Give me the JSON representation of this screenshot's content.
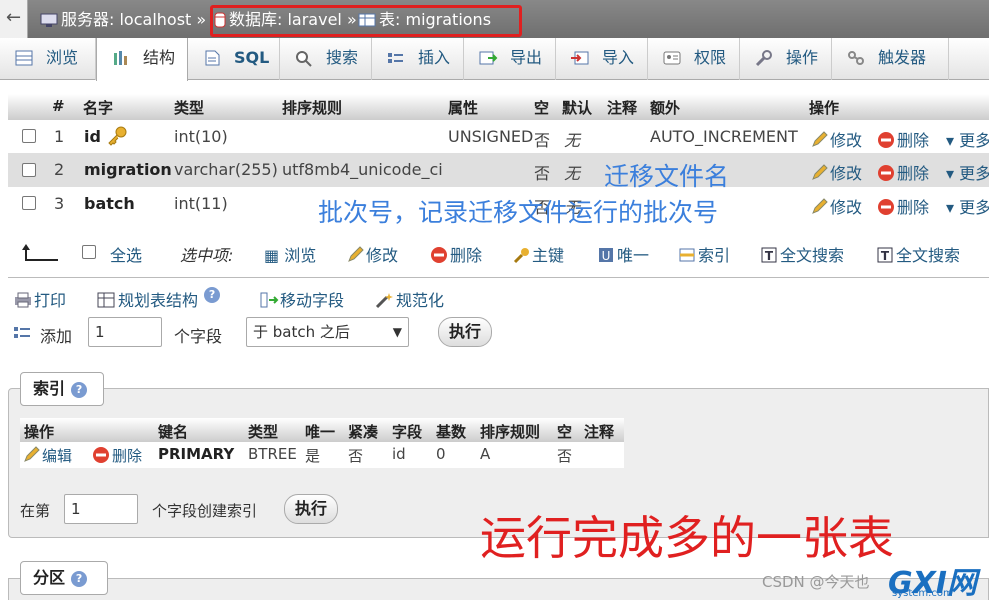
{
  "breadcrumb": {
    "back": "←",
    "server": "服务器: localhost",
    "sep1": "»",
    "database": "数据库: laravel",
    "sep2": "»",
    "table": "表: migrations"
  },
  "tabs": [
    "浏览",
    "结构",
    "SQL",
    "搜索",
    "插入",
    "导出",
    "导入",
    "权限",
    "操作",
    "触发器"
  ],
  "active_tab": "结构",
  "columns_header": [
    "#",
    "名字",
    "类型",
    "排序规则",
    "属性",
    "空",
    "默认",
    "注释",
    "额外",
    "操作"
  ],
  "rows": [
    {
      "num": "1",
      "name": "id",
      "type": "int(10)",
      "collation": "",
      "attributes": "UNSIGNED",
      "null": "否",
      "default": "无",
      "extra": "AUTO_INCREMENT",
      "edit": "修改",
      "drop": "删除",
      "more": "更多"
    },
    {
      "num": "2",
      "name": "migration",
      "type": "varchar(255)",
      "collation": "utf8mb4_unicode_ci",
      "attributes": "",
      "null": "否",
      "default": "无",
      "extra": "",
      "edit": "修改",
      "drop": "删除",
      "more": "更多"
    },
    {
      "num": "3",
      "name": "batch",
      "type": "int(11)",
      "collation": "",
      "attributes": "",
      "null": "否",
      "default": "无",
      "extra": "",
      "edit": "修改",
      "drop": "删除",
      "more": "更多"
    }
  ],
  "annotations": {
    "migration_note": "迁移文件名",
    "batch_note": "批次号，记录迁移文件运行的批次号",
    "result_note": "运行完成多的一张表"
  },
  "with_selected": {
    "check_all": "全选",
    "label": "选中项:",
    "actions": [
      "浏览",
      "修改",
      "删除",
      "主键",
      "唯一",
      "索引",
      "全文搜索",
      "全文搜索"
    ]
  },
  "tools": {
    "print": "打印",
    "propose": "规划表结构",
    "move": "移动字段",
    "normalize": "规范化"
  },
  "add_fields": {
    "label": "添加",
    "count": "1",
    "unit": "个字段",
    "position": "于 batch 之后",
    "go": "执行"
  },
  "indexes": {
    "legend": "索引",
    "header": [
      "操作",
      "键名",
      "类型",
      "唯一",
      "紧凑",
      "字段",
      "基数",
      "排序规则",
      "空",
      "注释"
    ],
    "row": {
      "edit": "编辑",
      "drop": "删除",
      "keyname": "PRIMARY",
      "type": "BTREE",
      "unique": "是",
      "packed": "否",
      "column": "id",
      "cardinality": "0",
      "collation": "A",
      "null": "否",
      "comment": ""
    },
    "create_prefix": "在第",
    "create_count": "1",
    "create_suffix": "个字段创建索引",
    "go": "执行"
  },
  "partitions": {
    "legend": "分区"
  },
  "watermark": "CSDN @今天也",
  "logo": {
    "text": "GXI网",
    "sub": "system.com"
  },
  "colors": {
    "accent": "#235a81",
    "annotation_blue": "#3b7fdc",
    "annotation_red": "#e02020"
  }
}
